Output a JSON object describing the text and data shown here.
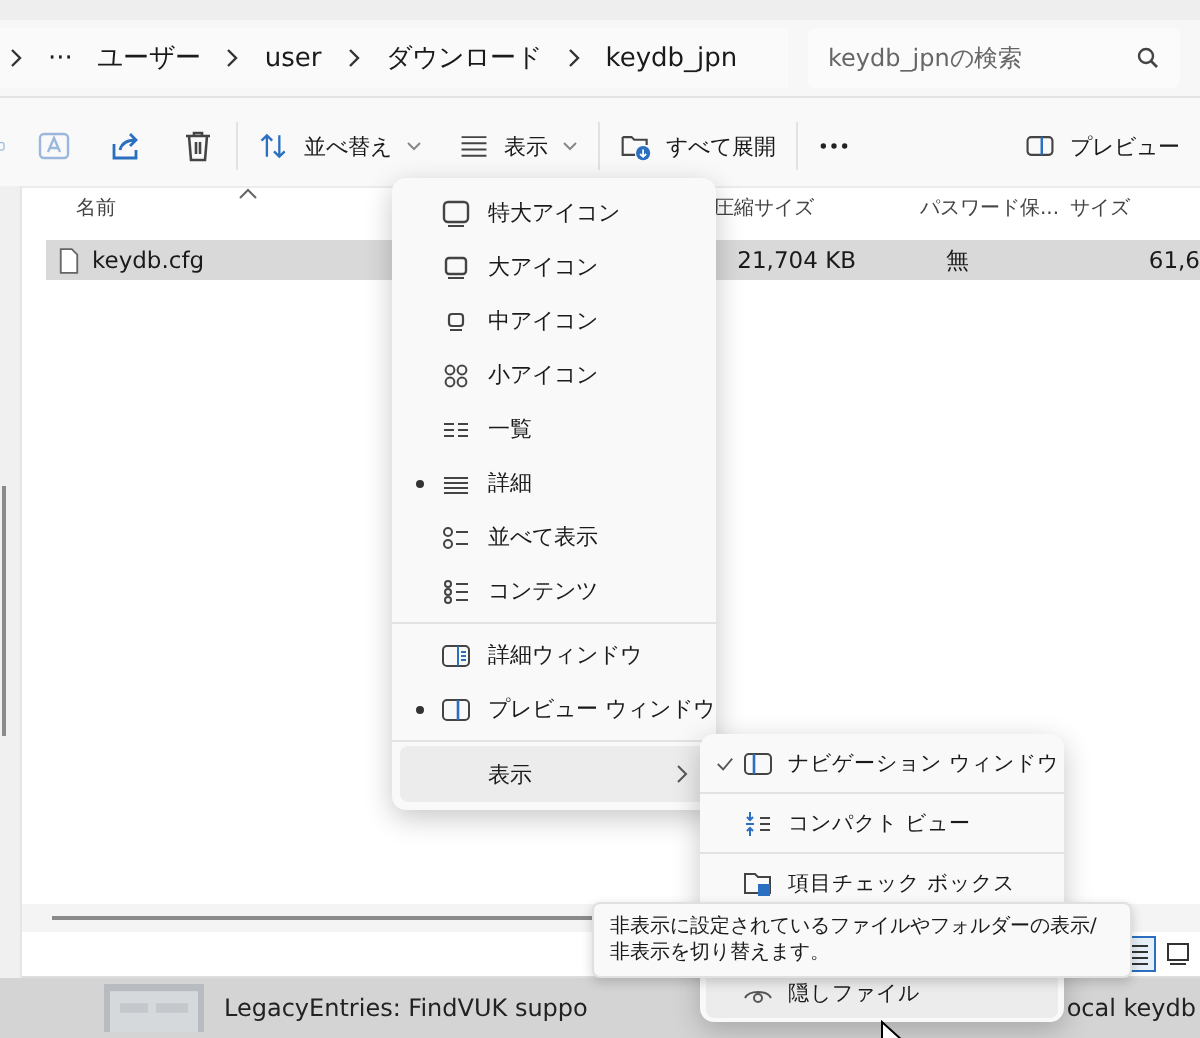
{
  "address_bar": {
    "overflow": "···",
    "crumbs": [
      "ユーザー",
      "user",
      "ダウンロード",
      "keydb_jpn"
    ]
  },
  "search": {
    "placeholder": "keydb_jpnの検索"
  },
  "toolbar": {
    "sort": "並べ替え",
    "view": "表示",
    "extract": "すべて展開",
    "preview": "プレビュー"
  },
  "columns": [
    "名前",
    "圧縮サイズ",
    "パスワード保...",
    "サイズ"
  ],
  "rows": [
    {
      "name": "keydb.cfg",
      "compressed_size": "21,704 KB",
      "password": "無",
      "size": "61,6",
      "selected": true
    }
  ],
  "view_menu": {
    "items": [
      {
        "kind": "layout",
        "label": "特大アイコン",
        "selected": false
      },
      {
        "kind": "layout",
        "label": "大アイコン",
        "selected": false
      },
      {
        "kind": "layout",
        "label": "中アイコン",
        "selected": false
      },
      {
        "kind": "layout",
        "label": "小アイコン",
        "selected": false
      },
      {
        "kind": "layout",
        "label": "一覧",
        "selected": false
      },
      {
        "kind": "layout",
        "label": "詳細",
        "selected": true
      },
      {
        "kind": "layout",
        "label": "並べて表示",
        "selected": false
      },
      {
        "kind": "layout",
        "label": "コンテンツ",
        "selected": false
      },
      {
        "kind": "pane",
        "label": "詳細ウィンドウ",
        "selected": false
      },
      {
        "kind": "pane",
        "label": "プレビュー ウィンドウ",
        "selected": true
      },
      {
        "kind": "submenu",
        "label": "表示",
        "expanded": true
      }
    ]
  },
  "show_submenu": {
    "items": [
      {
        "label": "ナビゲーション ウィンドウ",
        "checked": true,
        "highlighted": false
      },
      {
        "label": "コンパクト ビュー",
        "checked": false,
        "highlighted": false
      },
      {
        "label": "項目チェック ボックス",
        "checked": false,
        "highlighted": false
      },
      {
        "label": "隠しファイル",
        "checked": false,
        "highlighted": true
      }
    ]
  },
  "tooltip": "非表示に設定されているファイルやフォルダーの表示/非表示を切り替えます。",
  "status_bar": {
    "view_buttons": [
      {
        "selected": true
      },
      {
        "selected": false
      }
    ]
  },
  "background_window": {
    "text_left": "LegacyEntries: FindVUK suppo",
    "text_right": "ocal keydb"
  }
}
